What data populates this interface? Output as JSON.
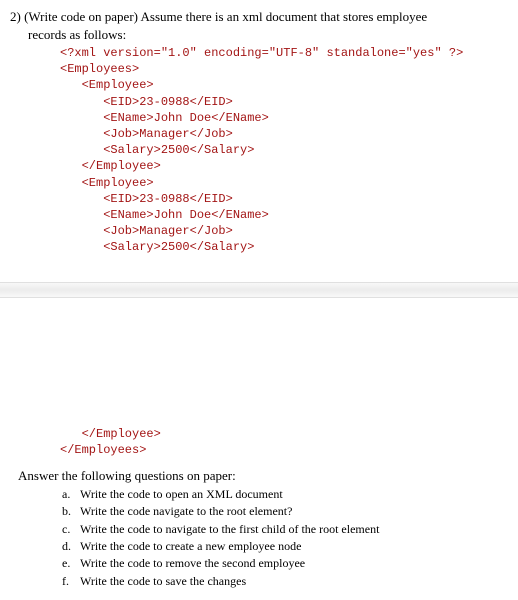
{
  "question": {
    "number": "2)",
    "intro_line1": "(Write code on paper) Assume there is an xml document that stores employee",
    "intro_line2": "records as follows:"
  },
  "xml_code_top": "<?xml version=\"1.0\" encoding=\"UTF-8\" standalone=\"yes\" ?>\n<Employees>\n   <Employee>\n      <EID>23-0988</EID>\n      <EName>John Doe</EName>\n      <Job>Manager</Job>\n      <Salary>2500</Salary>\n   </Employee>\n   <Employee>\n      <EID>23-0988</EID>\n      <EName>John Doe</EName>\n      <Job>Manager</Job>\n      <Salary>2500</Salary>",
  "xml_code_bottom": "   </Employee>\n</Employees>",
  "answer_header": "Answer the following questions on paper:",
  "answers": {
    "a": {
      "letter": "a.",
      "text": "Write the code to open an XML document"
    },
    "b": {
      "letter": "b.",
      "text": "Write the code navigate to the root element?"
    },
    "c": {
      "letter": "c.",
      "text": "Write the code to navigate to the first child of the root element"
    },
    "d": {
      "letter": "d.",
      "text": "Write the code to create a new employee node"
    },
    "e": {
      "letter": "e.",
      "text": "Write the code to remove the second employee"
    },
    "f": {
      "letter": "f.",
      "text": "Write the code to save the changes"
    }
  }
}
